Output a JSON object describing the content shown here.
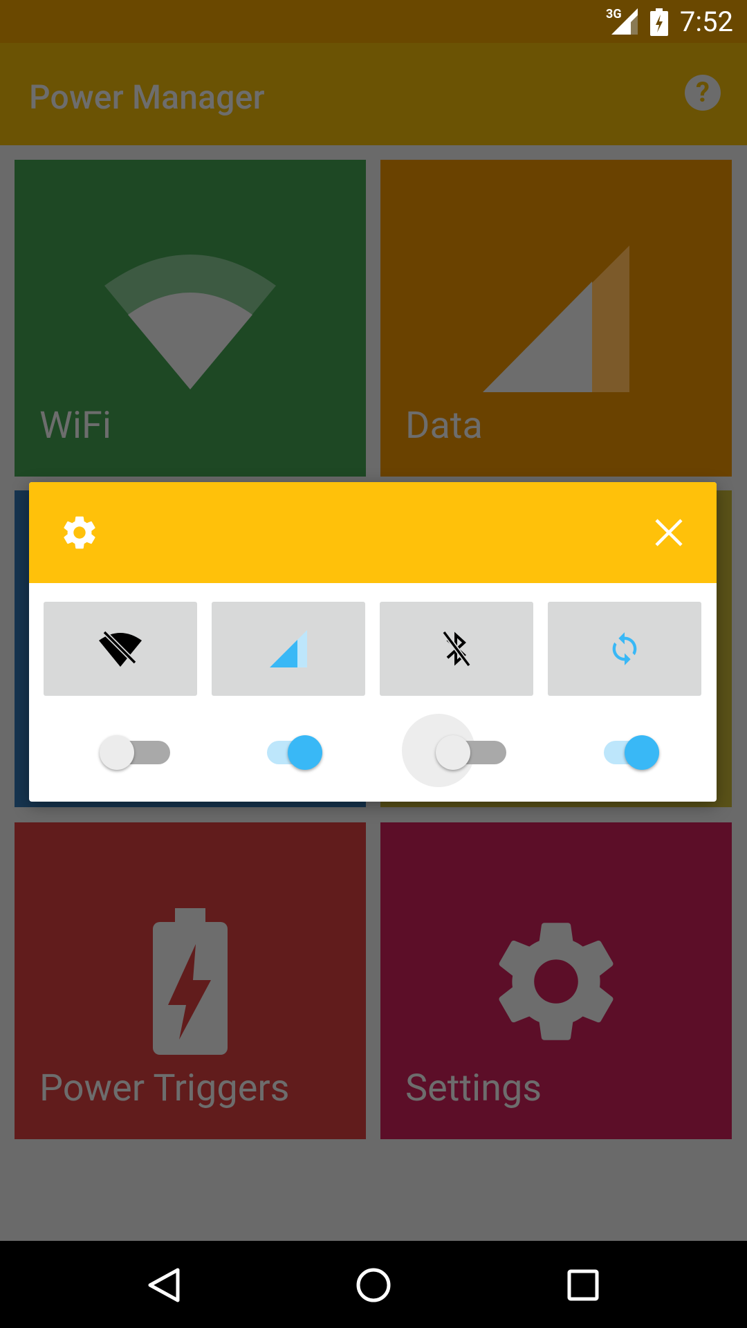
{
  "status_bar": {
    "network": "3G",
    "time": "7:52"
  },
  "app_bar": {
    "title": "Power Manager",
    "help_glyph": "?"
  },
  "tiles": [
    {
      "label": "WiFi",
      "icon": "wifi-icon",
      "color": "#1e4824"
    },
    {
      "label": "Data",
      "icon": "cell-signal-icon",
      "color": "#6a4200"
    },
    {
      "label": "Power Triggers",
      "icon": "battery-charging-icon",
      "color": "#611c1c"
    },
    {
      "label": "Settings",
      "icon": "gear-icon",
      "color": "#5c0e28"
    }
  ],
  "dialog": {
    "header_color": "#ffc10a",
    "header_icon": "gear-icon",
    "close_icon": "close-icon",
    "toggles": [
      {
        "name": "wifi",
        "icon": "wifi-off-icon",
        "on": false
      },
      {
        "name": "mobile-data",
        "icon": "cell-signal-icon",
        "on": true
      },
      {
        "name": "bluetooth",
        "icon": "bluetooth-disabled-icon",
        "on": false
      },
      {
        "name": "sync",
        "icon": "sync-icon",
        "on": true
      }
    ]
  },
  "colors": {
    "accent": "#39b8f6",
    "scrim": "#6a6a6a"
  }
}
